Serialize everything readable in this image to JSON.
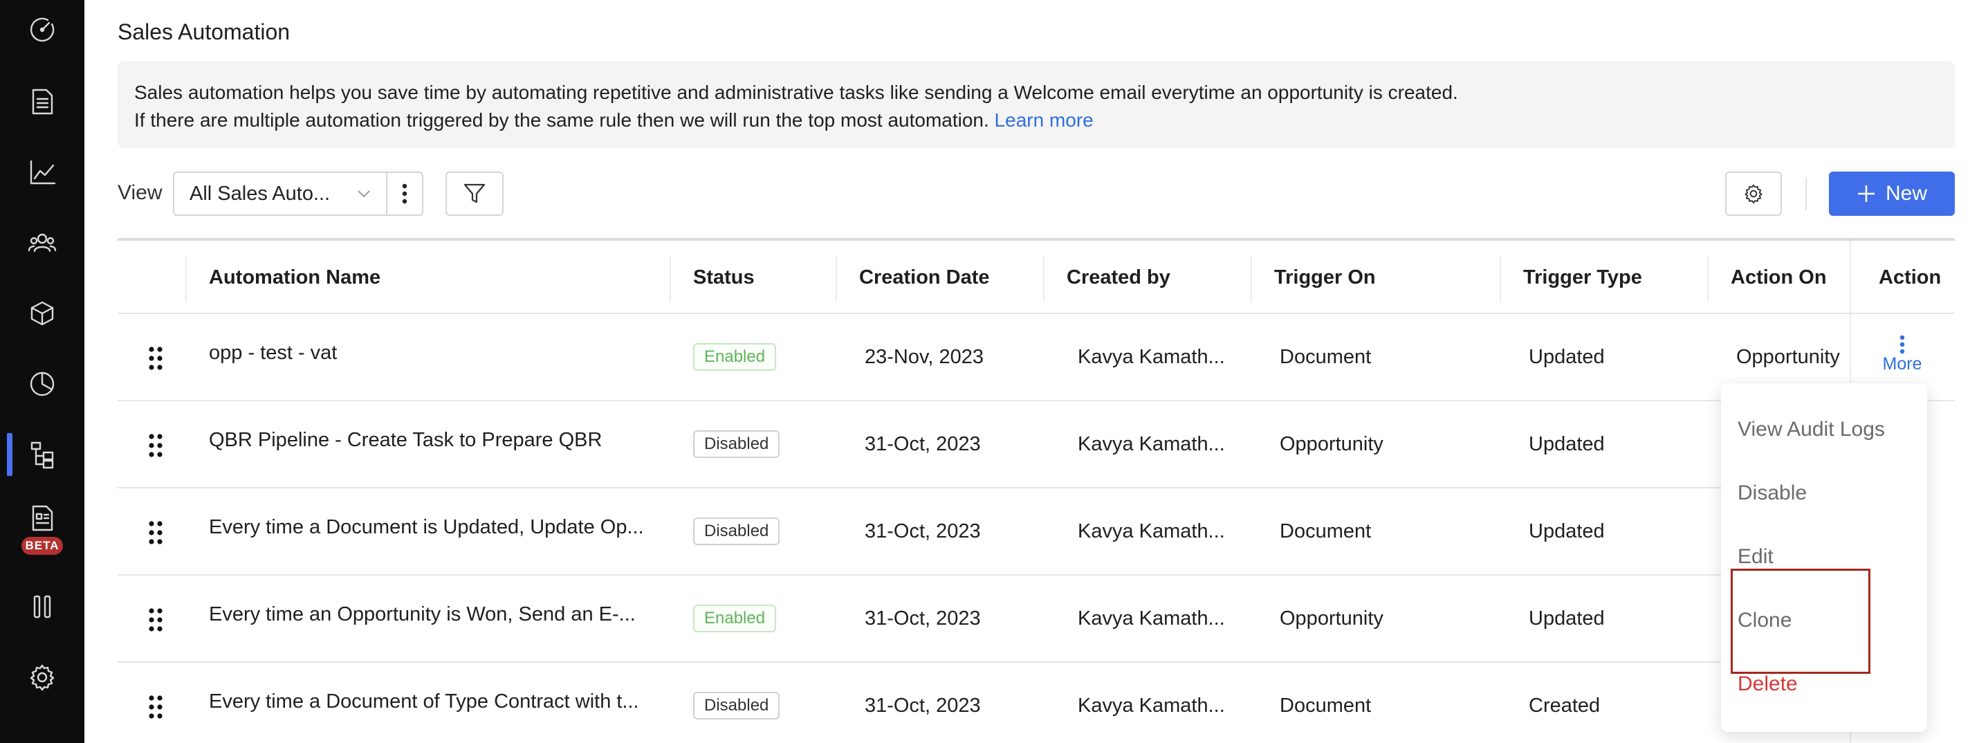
{
  "sidebar": {
    "items": [
      {
        "icon": "speedometer-icon"
      },
      {
        "icon": "document-icon"
      },
      {
        "icon": "trend-chart-icon"
      },
      {
        "icon": "users-icon"
      },
      {
        "icon": "cube-icon"
      },
      {
        "icon": "pie-chart-icon"
      },
      {
        "icon": "workflow-icon",
        "active": true
      },
      {
        "icon": "report-icon",
        "badge": "BETA"
      },
      {
        "icon": "columns-icon"
      },
      {
        "icon": "gear-icon"
      }
    ],
    "accent_color": "#4a72f5"
  },
  "page": {
    "title": "Sales Automation",
    "info_line1": "Sales automation helps you save time by automating repetitive and administrative tasks like sending a Welcome email everytime an opportunity is created.",
    "info_line2": "If there are multiple automation triggered by the same rule then we will run the top most automation.",
    "learn_more": "Learn more"
  },
  "toolbar": {
    "view_label": "View",
    "view_value": "All Sales Auto...",
    "new_label": "New",
    "primary_color": "#3f6ee8"
  },
  "table": {
    "columns": [
      "Automation Name",
      "Status",
      "Creation Date",
      "Created by",
      "Trigger On",
      "Trigger Type",
      "Action On",
      "Action"
    ],
    "rows": [
      {
        "name": "opp - test - vat",
        "status": "Enabled",
        "date": "23-Nov, 2023",
        "created_by": "Kavya Kamath...",
        "trigger_on": "Document",
        "trigger_type": "Updated",
        "action_on": "Opportunity"
      },
      {
        "name": "QBR Pipeline - Create Task to Prepare QBR",
        "status": "Disabled",
        "date": "31-Oct, 2023",
        "created_by": "Kavya Kamath...",
        "trigger_on": "Opportunity",
        "trigger_type": "Updated",
        "action_on": ""
      },
      {
        "name": "Every time a Document is Updated, Update Op...",
        "status": "Disabled",
        "date": "31-Oct, 2023",
        "created_by": "Kavya Kamath...",
        "trigger_on": "Document",
        "trigger_type": "Updated",
        "action_on": ""
      },
      {
        "name": "Every time an Opportunity is Won, Send an E-...",
        "status": "Enabled",
        "date": "31-Oct, 2023",
        "created_by": "Kavya Kamath...",
        "trigger_on": "Opportunity",
        "trigger_type": "Updated",
        "action_on": ""
      },
      {
        "name": "Every time a Document of Type Contract with t...",
        "status": "Disabled",
        "date": "31-Oct, 2023",
        "created_by": "Kavya Kamath...",
        "trigger_on": "Document",
        "trigger_type": "Created",
        "action_on": ""
      }
    ],
    "more_label": "More"
  },
  "dropdown": {
    "items": [
      "View Audit Logs",
      "Disable",
      "Edit",
      "Clone",
      "Delete"
    ],
    "highlighted": "Clone",
    "delete_color": "#d93838",
    "highlight_color": "#a4281f"
  }
}
